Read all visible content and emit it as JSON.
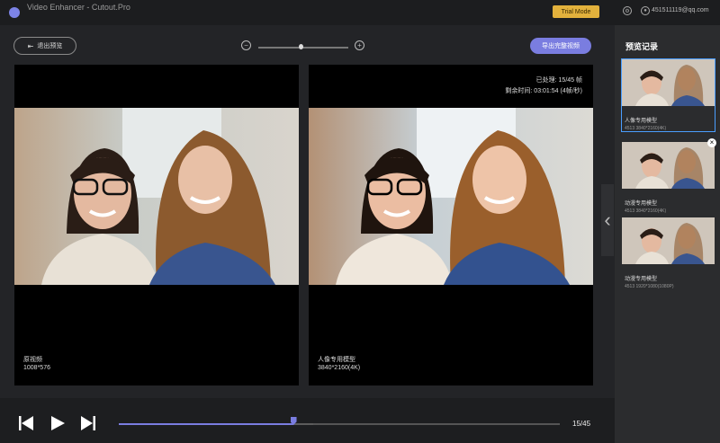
{
  "app": {
    "title": "Video Enhancer - Cutout.Pro",
    "trial_label": "Trial Mode",
    "email": "451511119@qq.com"
  },
  "toolbar": {
    "back_label": "退出预览",
    "export_label": "导出完整视频",
    "zoom_level": 0.47
  },
  "panels": {
    "left": {
      "caption": "原视频",
      "resolution": "1008*576"
    },
    "right": {
      "caption": "人像专用模型",
      "resolution": "3840*2160(4K)",
      "processed": "已处理: 15/45 帧",
      "remaining": "剩余时间: 03:01:54 (4帧/秒)"
    }
  },
  "sidebar": {
    "title": "预览记录",
    "items": [
      {
        "label": "人像专用模型",
        "sub": "4513  3840*2160(4K)"
      },
      {
        "label": "动漫专用模型",
        "sub": "4513  3840*2160(4K)"
      },
      {
        "label": "动漫专用模型",
        "sub": "4513  1920*1080(1080P)"
      }
    ]
  },
  "player": {
    "frame_count": "15/45",
    "progress": 0.396,
    "buffered": 0.44
  },
  "colors": {
    "accent": "#7a7de0",
    "trial": "#e2b13c",
    "background": "#232427"
  }
}
